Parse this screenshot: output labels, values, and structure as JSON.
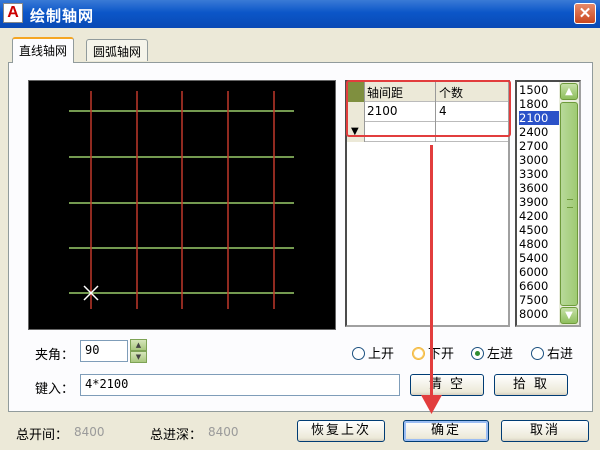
{
  "window": {
    "app_icon": "A",
    "title": "绘制轴网",
    "close_label": "✕"
  },
  "tabs": [
    {
      "label": "直线轴网",
      "active": true
    },
    {
      "label": "圆弧轴网",
      "active": false
    }
  ],
  "grid_table": {
    "headers": [
      "轴间距",
      "个数"
    ],
    "rows": [
      {
        "spacing": "2100",
        "count": "4"
      },
      {
        "spacing": "",
        "count": ""
      }
    ],
    "new_row_marker": "▼"
  },
  "spacing_list": {
    "items": [
      "1500",
      "1800",
      "2100",
      "2400",
      "2700",
      "3000",
      "3300",
      "3600",
      "3900",
      "4200",
      "4500",
      "4800",
      "5400",
      "6000",
      "6600",
      "7500",
      "8000"
    ],
    "selected": "2100"
  },
  "angle": {
    "label": "夹角：",
    "value": "90"
  },
  "options": [
    {
      "label": "上开",
      "checked": false
    },
    {
      "label": "下开",
      "checked": false
    },
    {
      "label": "左进",
      "checked": true
    },
    {
      "label": "右进",
      "checked": false
    }
  ],
  "keyin": {
    "label": "键入：",
    "value": "4*2100"
  },
  "buttons": {
    "clear": "清  空",
    "pick": "拾 取",
    "restore": "恢复上次",
    "ok": "确定",
    "cancel": "取消"
  },
  "status": {
    "total_width_label": "总开间：",
    "total_width_value": "8400",
    "total_depth_label": "总进深：",
    "total_depth_value": "8400"
  },
  "colors": {
    "title_bar": "#0b56c8",
    "preview_bg": "#000000",
    "axis_vertical": "#c0392b",
    "axis_horizontal": "#9acd6a",
    "annotation": "#e23d3d",
    "list_selected": "#2b52c8"
  }
}
